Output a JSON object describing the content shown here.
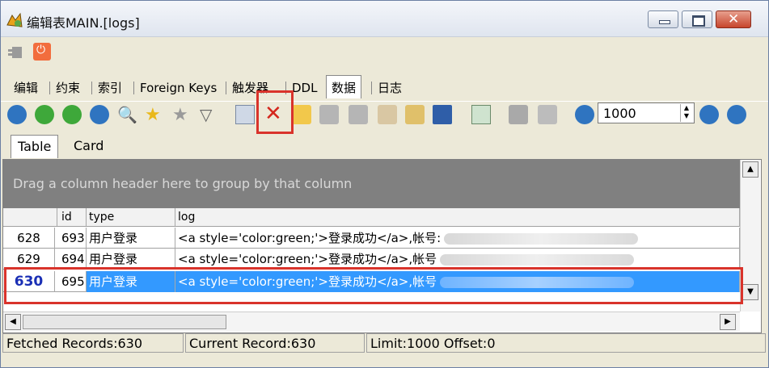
{
  "window": {
    "title": "编辑表MAIN.[logs]"
  },
  "tabs": [
    "编辑",
    "约束",
    "索引",
    "Foreign Keys",
    "触发器",
    "DDL",
    "数据",
    "日志"
  ],
  "active_tab": "数据",
  "toolbar": {
    "limit_value": "1000",
    "icons": [
      "first-record-icon",
      "prior-record-icon",
      "next-record-icon",
      "last-record-icon",
      "find-icon",
      "bookmark-icon",
      "bookmark-gray-icon",
      "filter-icon",
      "copy-icon",
      "delete-icon",
      "insert-icon",
      "post-icon",
      "cancel-icon",
      "refresh-icon",
      "export-icon",
      "save-icon",
      "import-icon",
      "print-icon",
      "print-preview-icon",
      "prev-page-icon",
      "next-page-icon",
      "last-page-icon"
    ]
  },
  "view_tabs": [
    "Table",
    "Card"
  ],
  "grid": {
    "group_hint": "Drag a column header here to group by that column",
    "columns": [
      "id",
      "type",
      "log"
    ],
    "rows": [
      {
        "rownum": "628",
        "id": "693",
        "type": "用户登录",
        "log": "<a style='color:green;'>登录成功</a>,帐号:"
      },
      {
        "rownum": "629",
        "id": "694",
        "type": "用户登录",
        "log": "<a style='color:green;'>登录成功</a>,帐号"
      },
      {
        "rownum": "630",
        "id": "695",
        "type": "用户登录",
        "log": "<a style='color:green;'>登录成功</a>,帐号"
      }
    ]
  },
  "status": {
    "fetched": "Fetched Records:630",
    "current": "Current Record:630",
    "limit": "Limit:1000 Offset:0"
  },
  "colors": {
    "selection": "#3399ff",
    "highlight": "#d9332b"
  }
}
